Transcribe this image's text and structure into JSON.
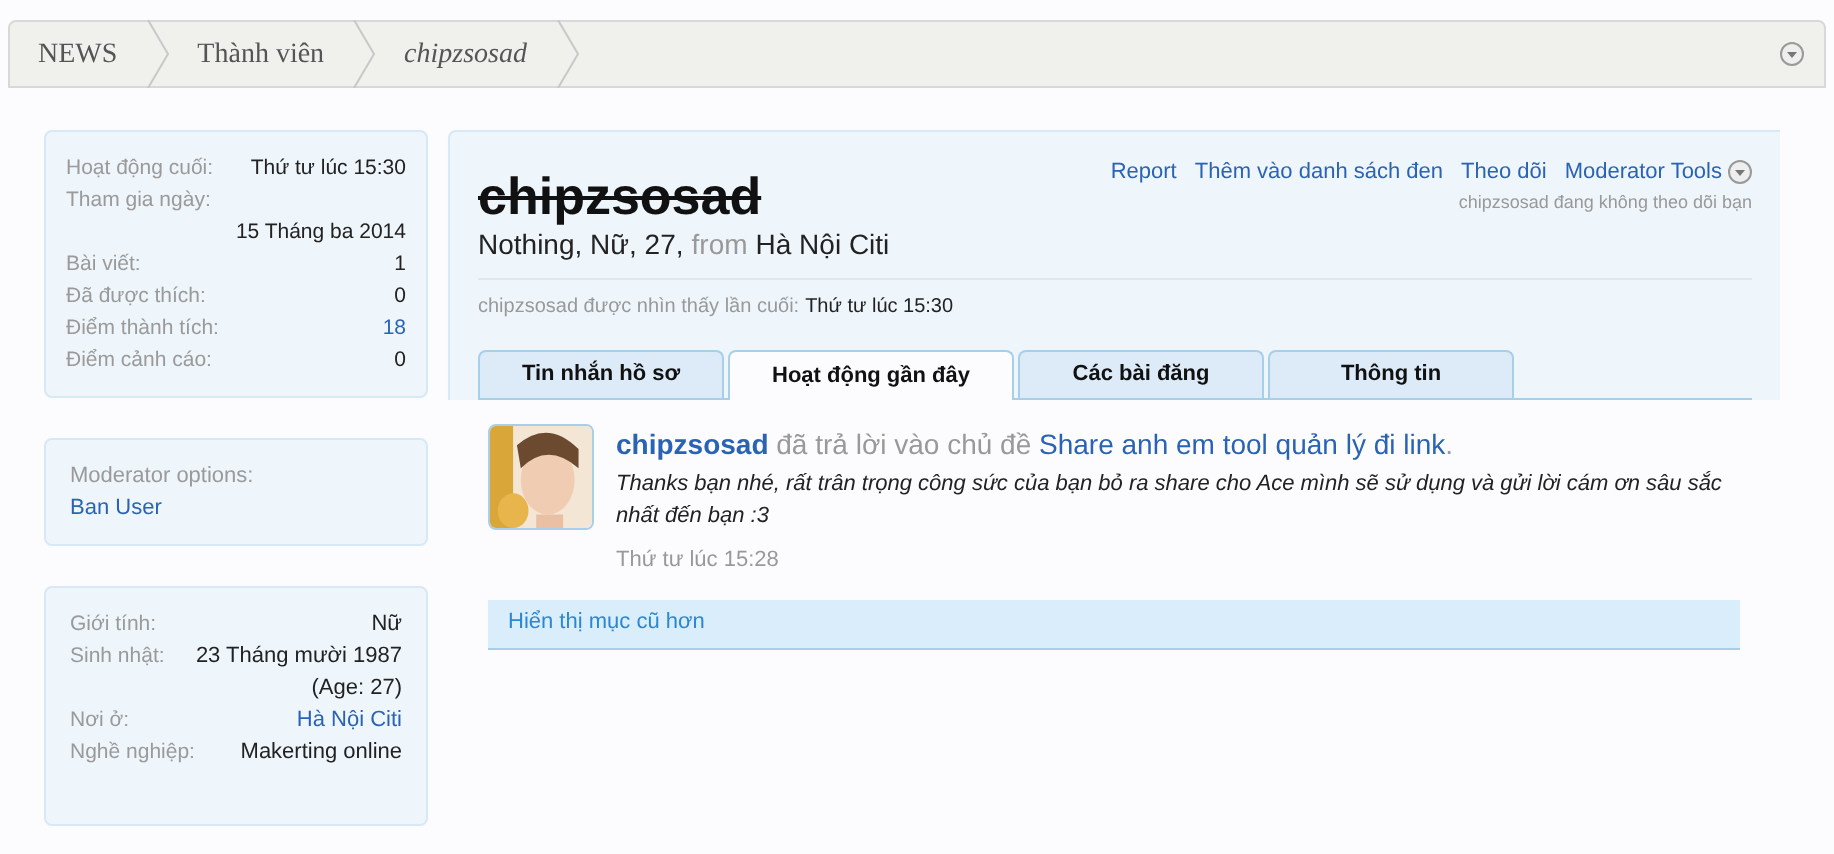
{
  "breadcrumb": [
    {
      "label": "NEWS",
      "current": false
    },
    {
      "label": "Thành viên",
      "current": false
    },
    {
      "label": "chipzsosad",
      "current": true
    }
  ],
  "sidebar": {
    "stats": [
      {
        "label": "Hoạt động cuối:",
        "value": "Thứ tư lúc 15:30",
        "kind": "inline"
      },
      {
        "label": "Tham gia ngày:",
        "value": "15 Tháng ba 2014",
        "kind": "block"
      },
      {
        "label": "Bài viết:",
        "value": "1",
        "kind": "inline"
      },
      {
        "label": "Đã được thích:",
        "value": "0",
        "kind": "inline"
      },
      {
        "label": "Điểm thành tích:",
        "value": "18",
        "kind": "link"
      },
      {
        "label": "Điểm cảnh cáo:",
        "value": "0",
        "kind": "inline"
      }
    ],
    "moderator": {
      "title": "Moderator options:",
      "link": "Ban User"
    },
    "info": [
      {
        "label": "Giới tính:",
        "value": "Nữ",
        "kind": "inline"
      },
      {
        "label": "Sinh nhật:",
        "value": "23 Tháng mười 1987",
        "note": "(Age: 27)",
        "kind": "inline"
      },
      {
        "label": "Nơi ở:",
        "value": "Hà Nội Citi",
        "kind": "link"
      },
      {
        "label": "Nghề nghiệp:",
        "value": "Makerting online",
        "kind": "inline"
      }
    ]
  },
  "profile": {
    "username": "chipzsosad",
    "banned": true,
    "details": "Nothing, Nữ, 27,",
    "from_word": "from",
    "location": "Hà Nội Citi",
    "actions": [
      "Report",
      "Thêm vào danh sách đen",
      "Theo dõi",
      "Moderator Tools"
    ],
    "follow_note": "chipzsosad đang không theo dõi bạn",
    "last_seen_label": "chipzsosad được nhìn thấy lần cuối:",
    "last_seen": "Thứ tư lúc 15:30"
  },
  "tabs": [
    {
      "label": "Tin nhắn hồ sơ",
      "selected": false
    },
    {
      "label": "Hoạt động gần đây",
      "selected": true
    },
    {
      "label": "Các bài đăng",
      "selected": false
    },
    {
      "label": "Thông tin",
      "selected": false
    }
  ],
  "activity": [
    {
      "user": "chipzsosad",
      "action": "đã trả lời vào chủ đề",
      "topic": "Share anh em tool quản lý đi link",
      "end_mark": ".",
      "snippet": "Thanks bạn nhé, rất trân trọng công sức của bạn bỏ ra share cho Ace mình sẽ sử dụng và gửi lời cám ơn sâu sắc nhất đến bạn :3",
      "time": "Thứ tư lúc 15:28"
    }
  ],
  "older_link": "Hiển thị mục cũ hơn"
}
